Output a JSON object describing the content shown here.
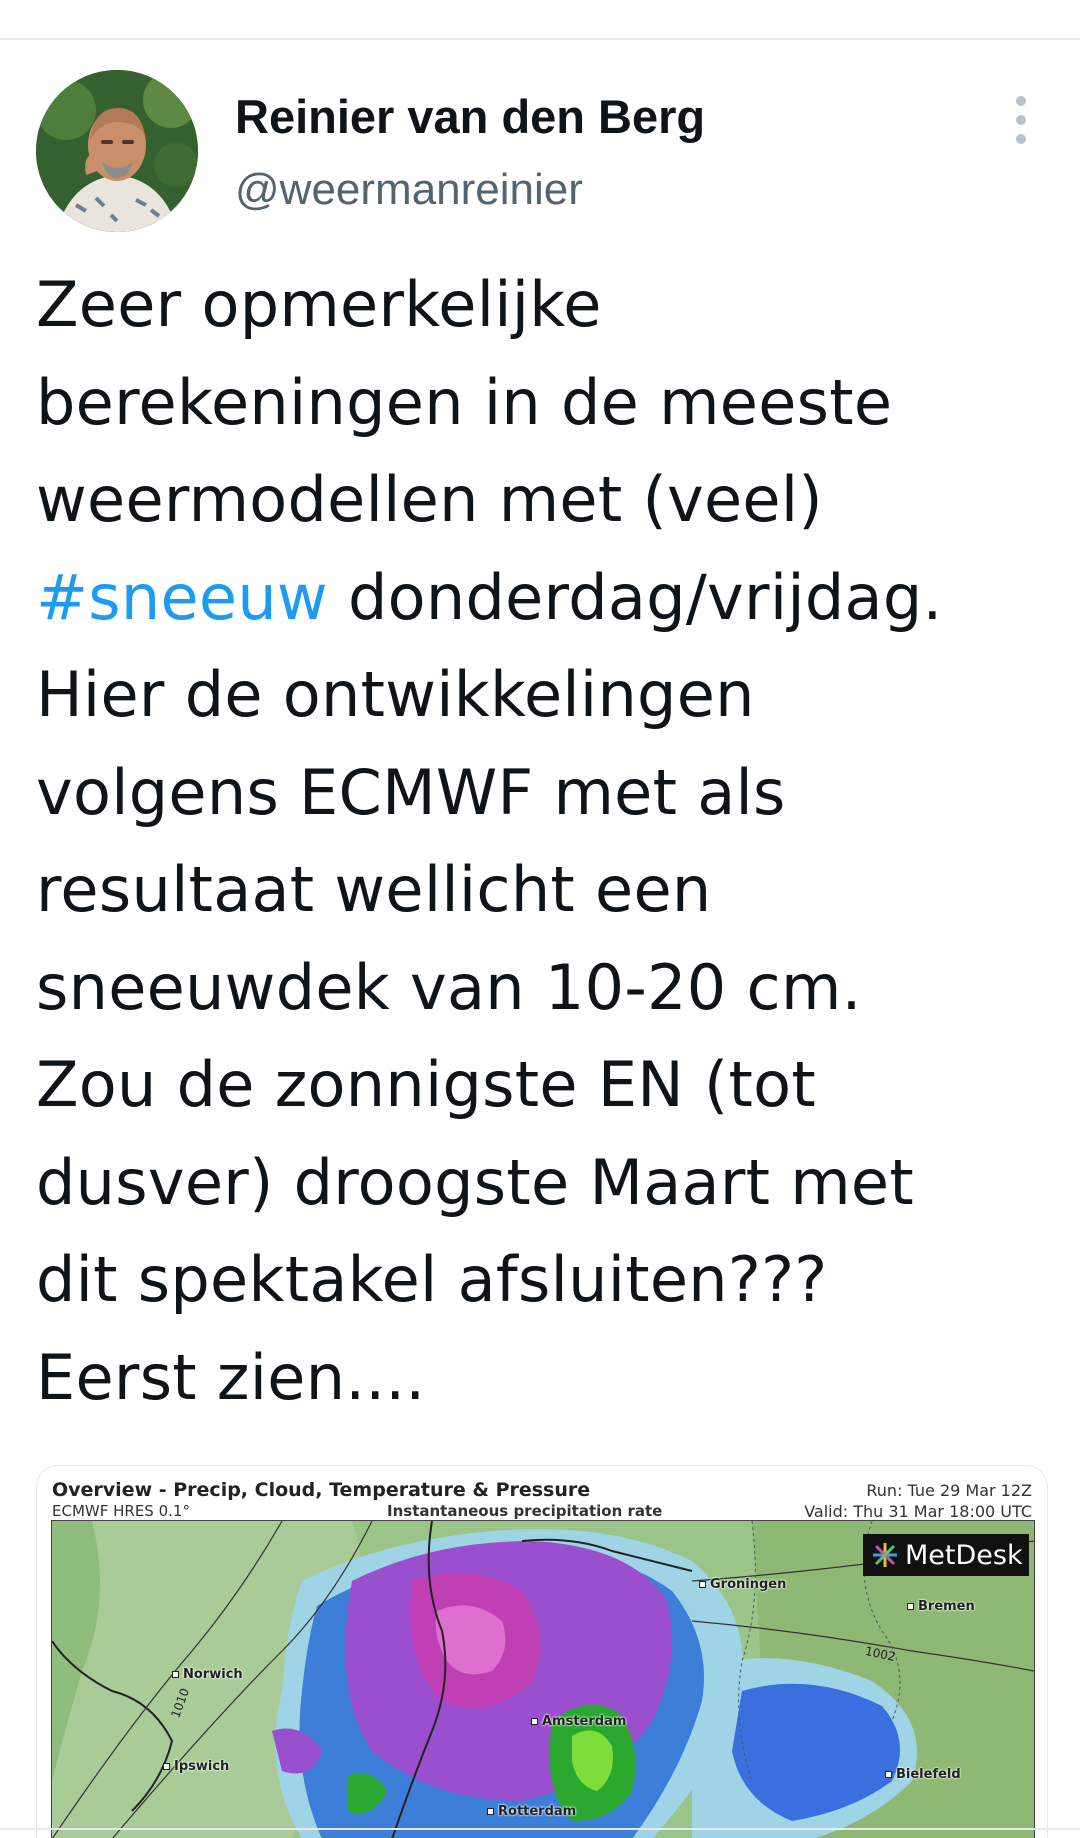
{
  "author": {
    "name": "Reinier van den Berg",
    "handle": "@weermanreinier",
    "avatar_icon": "profile-photo"
  },
  "more_icon": "more-vertical-icon",
  "tweet": {
    "lines": [
      {
        "text": "Zeer opmerkelijke"
      },
      {
        "text": "berekeningen in de meeste"
      },
      {
        "text": "weermodellen met (veel)"
      },
      {
        "hashtag": "#sneeuw",
        "text": " donderdag/vrijdag."
      },
      {
        "text": "Hier de ontwikkelingen"
      },
      {
        "text": "volgens ECMWF met als"
      },
      {
        "text": "resultaat wellicht een"
      },
      {
        "text": "sneeuwdek van 10-20 cm."
      },
      {
        "text": "Zou de zonnigste EN (tot"
      },
      {
        "text": "dusver) droogste Maart met"
      },
      {
        "text": "dit spektakel afsluiten???"
      },
      {
        "text": "Eerst zien...."
      }
    ],
    "hashtag_color": "#1d9bf0",
    "text_color": "#0f1419",
    "handle_color": "#536471"
  },
  "media": {
    "title": "Overview - Precip, Cloud, Temperature & Pressure",
    "model": "ECMWF HRES 0.1°",
    "subtitle": "Instantaneous precipitation rate",
    "run": "Run: Tue 29 Mar 12Z",
    "valid": "Valid: Thu 31 Mar 18:00 UTC",
    "logo_text": "MetDesk",
    "cities": [
      "Groningen",
      "Bremen",
      "Norwich",
      "Amsterdam",
      "Ipswich",
      "Rotterdam",
      "Bielefeld"
    ],
    "isobars": [
      "1002",
      "1010"
    ]
  }
}
